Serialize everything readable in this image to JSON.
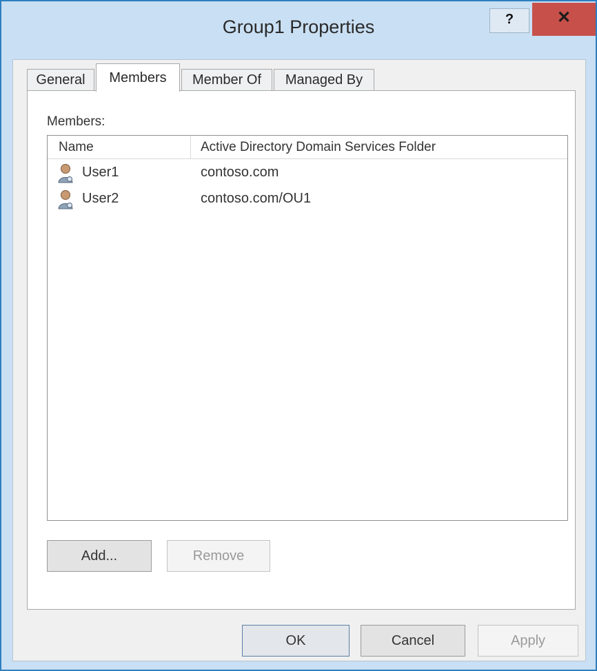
{
  "window": {
    "title": "Group1 Properties",
    "help_glyph": "?",
    "close_glyph": "✕"
  },
  "tabs": [
    {
      "label": "General",
      "active": false
    },
    {
      "label": "Members",
      "active": true
    },
    {
      "label": "Member Of",
      "active": false
    },
    {
      "label": "Managed By",
      "active": false
    }
  ],
  "members": {
    "caption": "Members:",
    "columns": [
      "Name",
      "Active Directory Domain Services Folder"
    ],
    "rows": [
      {
        "icon": "user-icon",
        "name": "User1",
        "folder": "contoso.com"
      },
      {
        "icon": "user-icon",
        "name": "User2",
        "folder": "contoso.com/OU1"
      }
    ],
    "add_label": "Add...",
    "remove_label": "Remove"
  },
  "footer": {
    "ok_label": "OK",
    "cancel_label": "Cancel",
    "apply_label": "Apply"
  }
}
